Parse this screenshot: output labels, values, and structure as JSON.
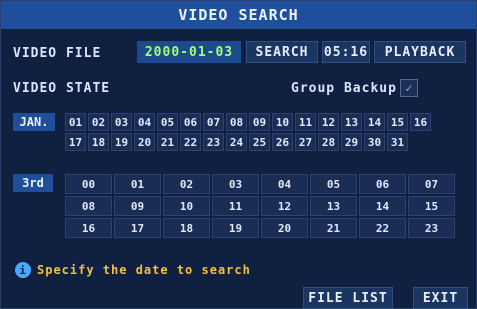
{
  "title": "VIDEO SEARCH",
  "row1": {
    "label": "VIDEO FILE",
    "date": "2000-01-03",
    "search_btn": "SEARCH",
    "time": "05:16",
    "playback_btn": "PLAYBACK"
  },
  "row2": {
    "label": "VIDEO STATE",
    "group_backup_label": "Group Backup",
    "group_backup_checked": true
  },
  "month": {
    "label": "JAN.",
    "days": [
      "01",
      "02",
      "03",
      "04",
      "05",
      "06",
      "07",
      "08",
      "09",
      "10",
      "11",
      "12",
      "13",
      "14",
      "15",
      "16",
      "17",
      "18",
      "19",
      "20",
      "21",
      "22",
      "23",
      "24",
      "25",
      "26",
      "27",
      "28",
      "29",
      "30",
      "31"
    ]
  },
  "hour": {
    "label": "3rd",
    "hours": [
      "00",
      "01",
      "02",
      "03",
      "04",
      "05",
      "06",
      "07",
      "08",
      "09",
      "10",
      "11",
      "12",
      "13",
      "14",
      "15",
      "16",
      "17",
      "18",
      "19",
      "20",
      "21",
      "22",
      "23"
    ]
  },
  "hint": {
    "text": "Specify the date to search",
    "icon": "info-icon"
  },
  "footer": {
    "file_list_btn": "FILE LIST",
    "exit_btn": "EXIT"
  },
  "colors": {
    "title_bar": "#1f4f9b",
    "date_text": "#a3ff6e",
    "hint_text": "#f0c43a"
  }
}
